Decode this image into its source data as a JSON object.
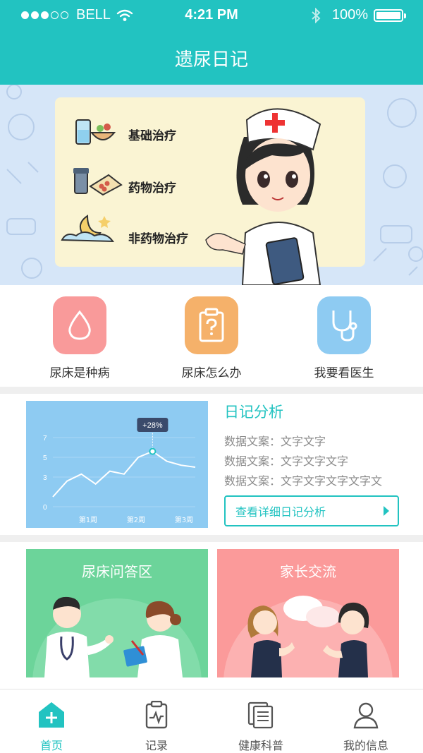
{
  "status_bar": {
    "carrier": "BELL",
    "time": "4:21 PM",
    "battery": "100%"
  },
  "nav": {
    "title": "遗尿日记"
  },
  "banner": {
    "items": [
      {
        "label": "基础治疗"
      },
      {
        "label": "药物治疗"
      },
      {
        "label": "非药物治疗"
      }
    ]
  },
  "quick": [
    {
      "label": "尿床是种病",
      "color": "#f99a9a"
    },
    {
      "label": "尿床怎么办",
      "color": "#f5b16a"
    },
    {
      "label": "我要看医生",
      "color": "#8ecbf2"
    }
  ],
  "analysis": {
    "title": "日记分析",
    "lines": [
      {
        "key": "数据文案：",
        "value": "文字文字"
      },
      {
        "key": "数据文案：",
        "value": "文字文字文字"
      },
      {
        "key": "数据文案：",
        "value": "文字文字文字文字文"
      }
    ],
    "button": "查看详细日记分析",
    "chart_data": {
      "type": "line",
      "y_ticks": [
        "7",
        "5",
        "3",
        "0"
      ],
      "ylim": [
        0,
        7
      ],
      "x_ticks": [
        "第1周",
        "第2周",
        "第3周"
      ],
      "series": [
        {
          "values": [
            1.0,
            2.6,
            3.3,
            2.3,
            3.6,
            3.3,
            5.0,
            5.6,
            4.6,
            4.2,
            4.0
          ]
        }
      ],
      "annotation": {
        "label": "+28%"
      }
    }
  },
  "cards": [
    {
      "title": "尿床问答区",
      "color": "#6cd49a"
    },
    {
      "title": "家长交流",
      "color": "#fb9a9a"
    }
  ],
  "tabs": [
    {
      "label": "首页",
      "active": true
    },
    {
      "label": "记录",
      "active": false
    },
    {
      "label": "健康科普",
      "active": false
    },
    {
      "label": "我的信息",
      "active": false
    }
  ],
  "colors": {
    "accent": "#22c3c1"
  }
}
